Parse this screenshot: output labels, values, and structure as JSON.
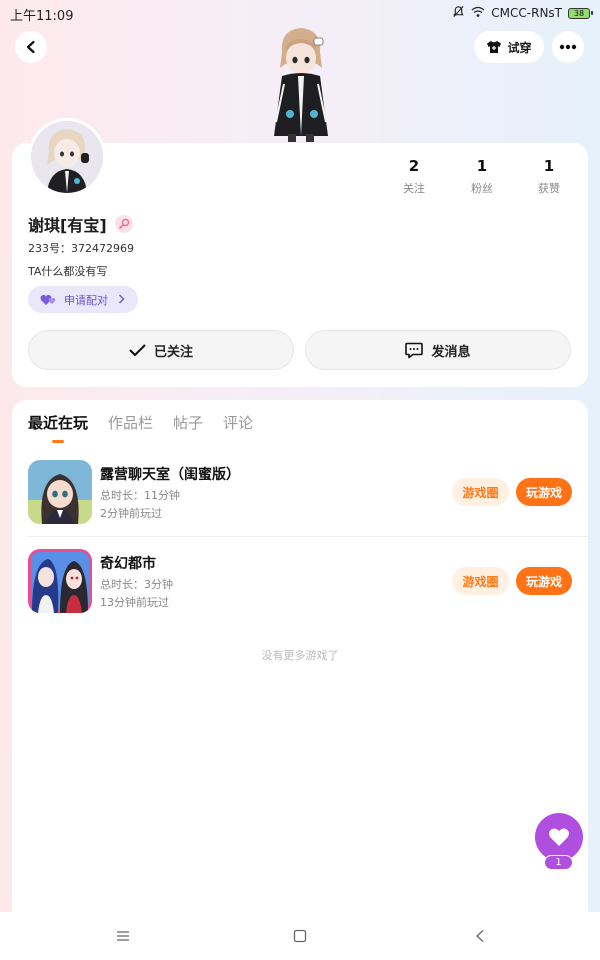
{
  "status_bar": {
    "time": "上午11:09",
    "carrier": "CMCC-RNsT",
    "battery": "38"
  },
  "header": {
    "tryon_label": "试穿"
  },
  "profile": {
    "name": "谢琪[有宝]",
    "uid": "233号：372472969",
    "bio": "TA什么都没有写",
    "pair_label": "申请配对",
    "stats": [
      {
        "value": "2",
        "label": "关注"
      },
      {
        "value": "1",
        "label": "粉丝"
      },
      {
        "value": "1",
        "label": "获赞"
      }
    ],
    "follow_label": "已关注",
    "message_label": "发消息"
  },
  "tabs": [
    "最近在玩",
    "作品栏",
    "帖子",
    "评论"
  ],
  "games": [
    {
      "title": "露营聊天室（闺蜜版）",
      "duration": "总时长：11分钟",
      "last_played": "2分钟前玩过",
      "circle_label": "游戏圈",
      "play_label": "玩游戏"
    },
    {
      "title": "奇幻都市",
      "duration": "总时长：3分钟",
      "last_played": "13分钟前玩过",
      "circle_label": "游戏圈",
      "play_label": "玩游戏"
    }
  ],
  "no_more_text": "没有更多游戏了",
  "fab": {
    "count": "1"
  },
  "colors": {
    "accent": "#ff7316",
    "purple": "#b04ee0",
    "pair_text": "#6c55c9"
  }
}
